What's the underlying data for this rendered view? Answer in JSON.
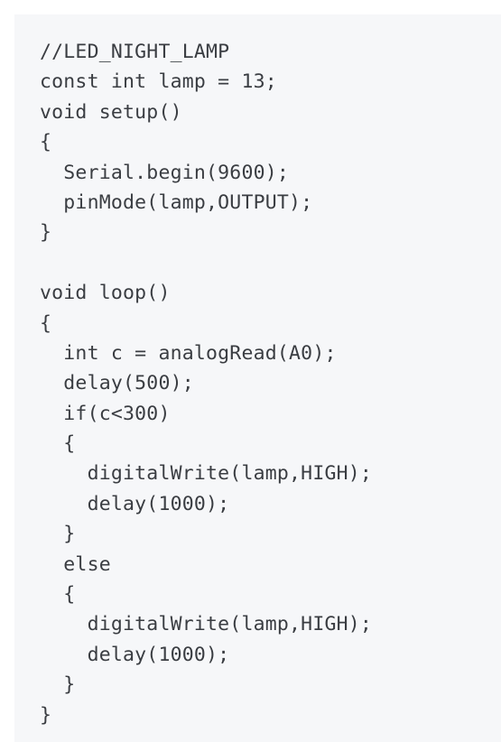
{
  "code": {
    "lines": [
      "//LED_NIGHT_LAMP",
      "const int lamp = 13;",
      "void setup()",
      "{",
      "  Serial.begin(9600);",
      "  pinMode(lamp,OUTPUT);",
      "}",
      "",
      "void loop()",
      "{",
      "  int c = analogRead(A0);",
      "  delay(500);",
      "  if(c<300)",
      "  {",
      "    digitalWrite(lamp,HIGH);",
      "    delay(1000);",
      "  }",
      "  else",
      "  {",
      "    digitalWrite(lamp,HIGH);",
      "    delay(1000);",
      "  }",
      "}"
    ]
  },
  "colors": {
    "panel_background": "#f6f7f9",
    "code_text": "#3a3d42"
  }
}
